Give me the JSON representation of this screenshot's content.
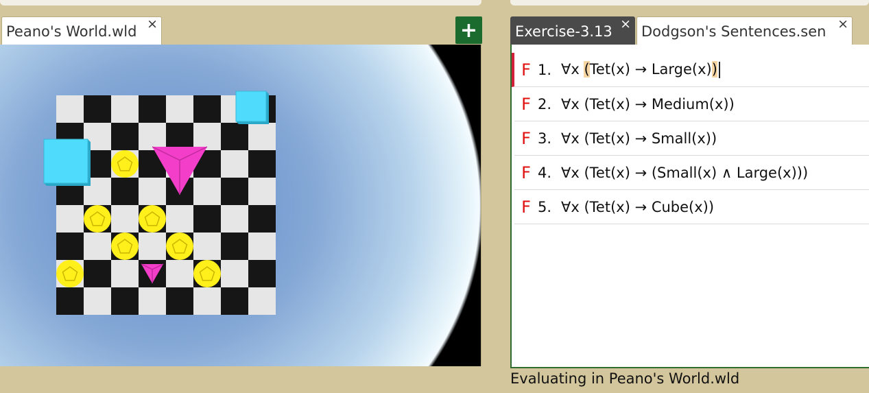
{
  "left_pane": {
    "tab_label": "Peano's World.wld",
    "close_glyph": "×",
    "add_glyph": "+"
  },
  "right_pane": {
    "tabs": [
      {
        "label": "Exercise-3.13",
        "close_glyph": "×"
      },
      {
        "label": "Dodgson's Sentences.sen",
        "close_glyph": "×"
      }
    ],
    "sentences": [
      {
        "value": "F",
        "number": "1.",
        "pre": "∀x ",
        "hl_open": "(",
        "mid": "Tet(x) → Large(x)",
        "hl_close": ")"
      },
      {
        "value": "F",
        "number": "2.",
        "formula": "∀x (Tet(x) → Medium(x))"
      },
      {
        "value": "F",
        "number": "3.",
        "formula": "∀x (Tet(x) → Small(x))"
      },
      {
        "value": "F",
        "number": "4.",
        "formula": "∀x (Tet(x) → (Small(x) ∧ Large(x)))"
      },
      {
        "value": "F",
        "number": "5.",
        "formula": "∀x (Tet(x) → Cube(x))"
      }
    ],
    "status": "Evaluating in Peano's World.wld"
  },
  "colors": {
    "truth_false": "#e01010",
    "add_button": "#1c6b2e",
    "active_tab": "#4a4a4a",
    "tet": "#f23ec8",
    "dodec": "#ffef1a",
    "cube": "#4fdcfc",
    "background": "#d4c69c"
  },
  "world_objects": [
    {
      "shape": "cube",
      "size": "large",
      "col": 0,
      "row": 2
    },
    {
      "shape": "cube",
      "size": "medium",
      "col": 6,
      "row": 0
    },
    {
      "shape": "tet",
      "size": "large",
      "col": 4,
      "row": 2
    },
    {
      "shape": "tet",
      "size": "small",
      "col": 3,
      "row": 6
    },
    {
      "shape": "dodec",
      "size": "medium",
      "col": 2,
      "row": 2
    },
    {
      "shape": "dodec",
      "size": "medium",
      "col": 1,
      "row": 4
    },
    {
      "shape": "dodec",
      "size": "medium",
      "col": 3,
      "row": 4
    },
    {
      "shape": "dodec",
      "size": "medium",
      "col": 2,
      "row": 5
    },
    {
      "shape": "dodec",
      "size": "medium",
      "col": 4,
      "row": 5
    },
    {
      "shape": "dodec",
      "size": "medium",
      "col": 0,
      "row": 6
    },
    {
      "shape": "dodec",
      "size": "medium",
      "col": 5,
      "row": 6
    }
  ]
}
